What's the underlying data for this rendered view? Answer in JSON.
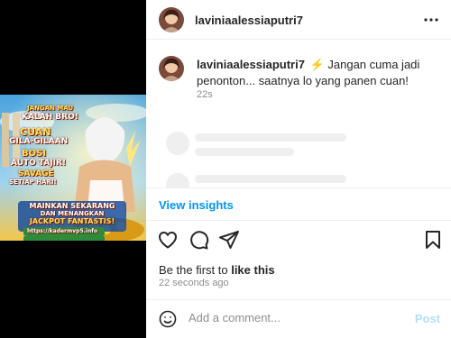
{
  "media": {
    "ad_lines": [
      "JANGAN MAU",
      "KALAH BRO!",
      "CUAN",
      "GILA-GILAAN",
      "BOSI",
      "AUTO TAJIR!",
      "SAVAGE",
      "SETIAP HARI!",
      "MAINKAN SEKARANG",
      "DAN MENANGKAN",
      "JACKPOT FANTASTIS!",
      "https://kadermvp5.info"
    ],
    "colors": {
      "sky": "#5fb3e0",
      "gold": "#e2a520",
      "banner": "#1e5aa8"
    }
  },
  "post": {
    "username": "laviniaalessiaputri7",
    "more_icon": "more-horizontal-icon"
  },
  "caption": {
    "username": "laviniaalessiaputri7",
    "emoji": "⚡",
    "text": "Jangan cuma jadi penonton... saatnya lo yang panen cuan!",
    "time": "22s"
  },
  "insights_label": "View insights",
  "actions": {
    "like_icon": "heart-icon",
    "comment_icon": "comment-icon",
    "share_icon": "send-icon",
    "save_icon": "bookmark-icon"
  },
  "likes": {
    "prefix": "Be the first to ",
    "link": "like this"
  },
  "time_ago": "22 seconds ago",
  "comment": {
    "placeholder": "Add a comment...",
    "post_label": "Post"
  },
  "colors": {
    "accent": "#0095f6",
    "muted": "#8e8e8e",
    "post_disabled": "#b2dffc"
  }
}
